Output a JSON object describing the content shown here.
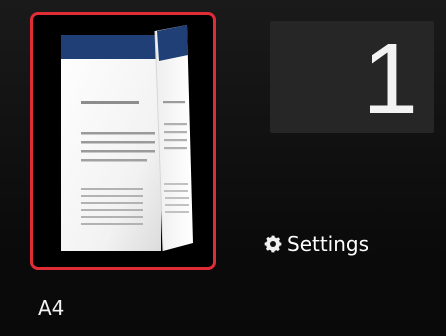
{
  "preview": {
    "selected": true,
    "border_color": "#e02c36"
  },
  "copies": {
    "value": "1"
  },
  "settings": {
    "label": "Settings",
    "icon": "gear-icon"
  },
  "paper": {
    "size": "A4"
  }
}
